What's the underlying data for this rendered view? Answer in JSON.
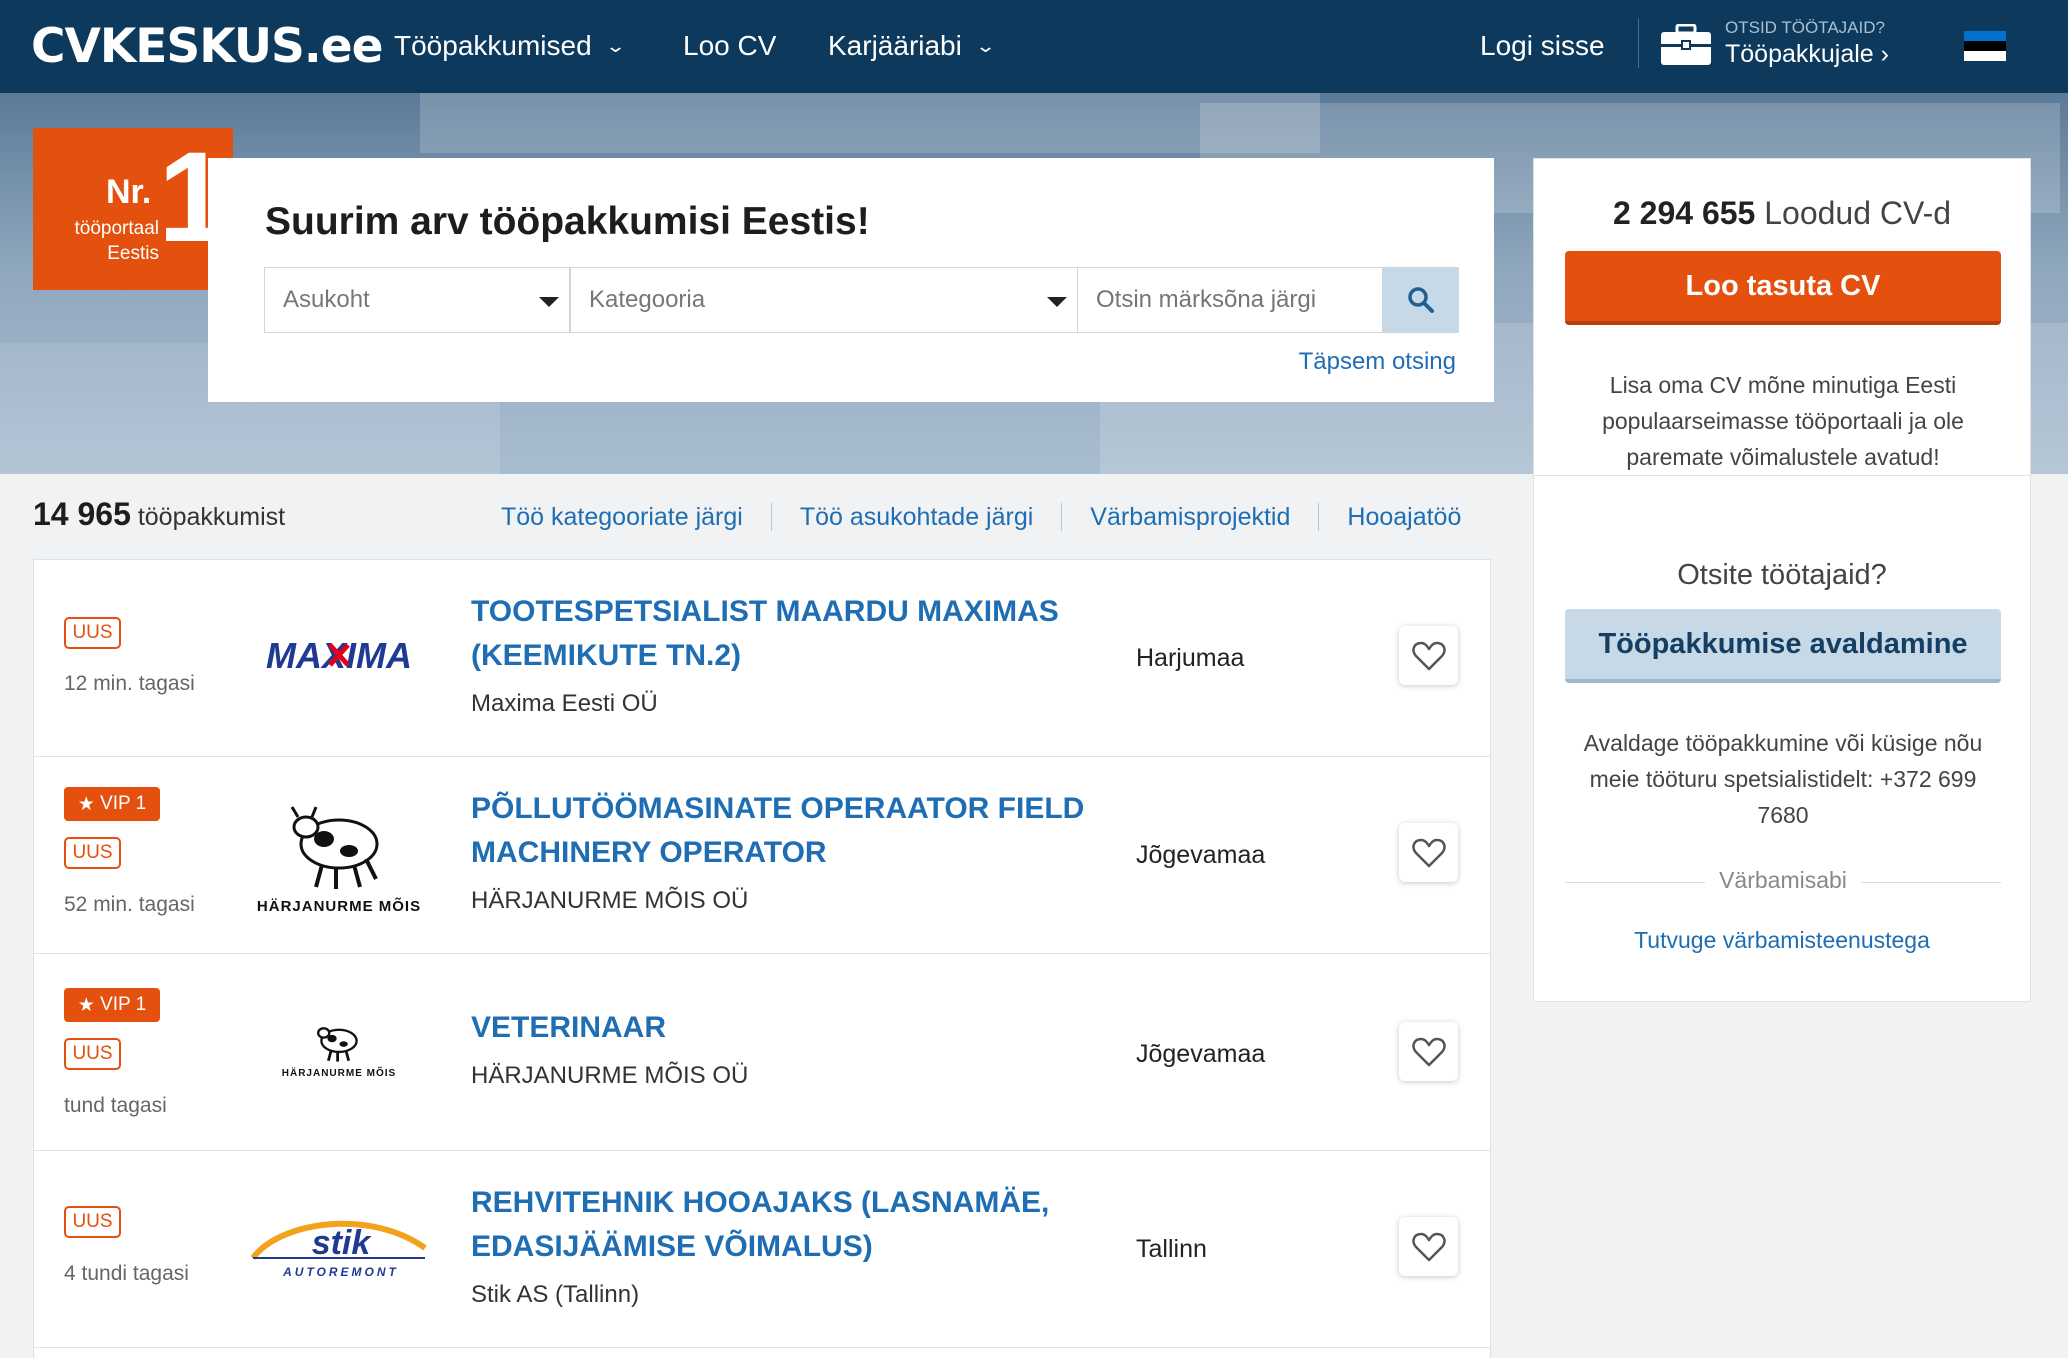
{
  "header": {
    "logo_cv": "CV",
    "logo_keskus": "KESKUS",
    "logo_ee": ".ee",
    "nav": [
      {
        "label": "Tööpakkumised"
      },
      {
        "label": "Loo CV"
      },
      {
        "label": "Karjääriabi"
      }
    ],
    "login": "Logi sisse",
    "employer_small": "OTSID TÖÖTAJAID?",
    "employer_big": "Tööpakkujale ›",
    "flag_colors": [
      "#0072ce",
      "#000000",
      "#ffffff"
    ]
  },
  "hero": {
    "badge_nr": "Nr.",
    "badge_one": "1",
    "badge_line1": "tööportaal",
    "badge_line2": "Eestis",
    "title": "Suurim arv tööpakkumisi Eestis!",
    "location_select": "Asukoht",
    "category_select": "Kategooria",
    "keyword_placeholder": "Otsin märksõna järgi",
    "advanced_search": "Täpsem otsing"
  },
  "sidebar": {
    "cv_count": "2 294 655",
    "cv_count_label": "Loodud CV-d",
    "create_cv_button": "Loo tasuta CV",
    "create_cv_text": "Lisa oma CV mõne minutiga Eesti populaarseimasse tööportaali ja ole paremate võimalustele avatud!",
    "employer_question": "Otsite töötajaid?",
    "publish_button": "Tööpakkumise avaldamine",
    "publish_text": "Avaldage tööpakkumine või küsige nõu meie tööturu spetsialistidelt: +372 699 7680",
    "recruit_label": "Värbamisabi",
    "recruit_link": "Tutvuge värbamisteenustega"
  },
  "list_header": {
    "count": "14 965",
    "count_label": "tööpakkumist",
    "filters": [
      "Töö kategooriate järgi",
      "Töö asukohtade järgi",
      "Värbamisprojektid",
      "Hooajatöö"
    ]
  },
  "jobs": [
    {
      "vip": "",
      "new": "UUS",
      "time": "12 min. tagasi",
      "logo": "MAXIMA",
      "title": "Tootespetsialist Maardu Maximas (Keemikute tn.2)",
      "company": "Maxima Eesti OÜ",
      "location": "Harjumaa"
    },
    {
      "vip": "VIP 1",
      "new": "UUS",
      "time": "52 min. tagasi",
      "logo": "HÄRJANURME MÕIS",
      "title": "Põllutöömasinate operaator Field machinery operator",
      "company": "HÄRJANURME MÕIS OÜ",
      "location": "Jõgevamaa"
    },
    {
      "vip": "VIP 1",
      "new": "UUS",
      "time": "tund tagasi",
      "logo": "HÄRJANURME MÕIS",
      "title": "Veterinaar",
      "company": "HÄRJANURME MÕIS OÜ",
      "location": "Jõgevamaa"
    },
    {
      "vip": "",
      "new": "UUS",
      "time": "4 tundi tagasi",
      "logo": "stik",
      "logo_sub": "AUTOREMONT",
      "title": "Rehvitehnik hooajaks (Lasnamäe, edasijäämise võimalus)",
      "company": "Stik AS (Tallinn)",
      "location": "Tallinn"
    }
  ],
  "colors": {
    "navy": "#0d3a5c",
    "orange": "#e4500e",
    "link_blue": "#1f6db2",
    "light_blue": "#c7d8e6"
  }
}
